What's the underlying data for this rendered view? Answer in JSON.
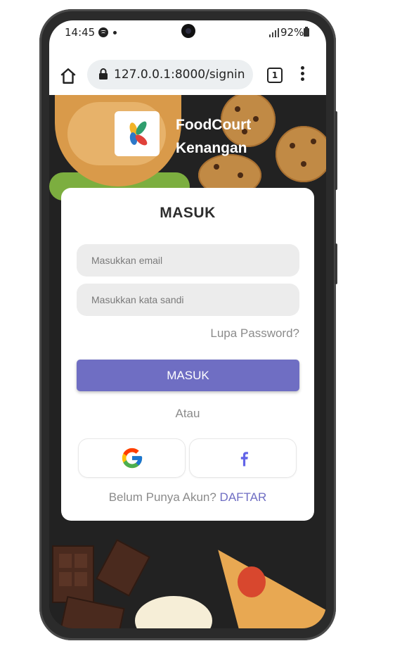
{
  "statusbar": {
    "time": "14:45",
    "battery": "92%"
  },
  "browser": {
    "url": "127.0.0.1:8000/signin",
    "tab_count": "1"
  },
  "brand": {
    "name_line1": "FoodCourt",
    "name_line2": "Kenangan"
  },
  "login": {
    "title": "MASUK",
    "email_placeholder": "Masukkan email",
    "password_placeholder": "Masukkan kata sandi",
    "forgot_label": "Lupa Password?",
    "submit_label": "MASUK",
    "or_label": "Atau",
    "register_prompt": "Belum Punya Akun?",
    "register_link": "DAFTAR"
  },
  "social": {
    "google_icon": "google-icon",
    "facebook_icon": "facebook-icon",
    "facebook_glyph": "f"
  },
  "colors": {
    "accent": "#6F6EC3",
    "facebook": "#6264E8"
  }
}
